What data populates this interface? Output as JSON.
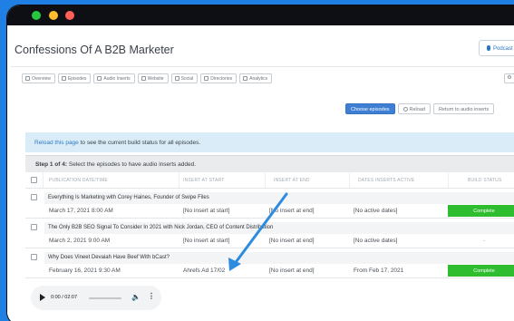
{
  "page": {
    "title": "Confessions Of A B2B Marketer",
    "podcast_button": "Podcast"
  },
  "tabs": [
    {
      "label": "Overview",
      "icon": "dashboard-icon"
    },
    {
      "label": "Episodes",
      "icon": "microphone-icon"
    },
    {
      "label": "Audio Inserts",
      "icon": "audio-wave-icon"
    },
    {
      "label": "Website",
      "icon": "globe-icon"
    },
    {
      "label": "Social",
      "icon": "share-icon"
    },
    {
      "label": "Directories",
      "icon": "list-icon"
    },
    {
      "label": "Analytics",
      "icon": "chart-icon"
    }
  ],
  "actions": {
    "choose_episodes": "Choose episodes",
    "reload": "Reload",
    "return": "Return to audio inserts"
  },
  "info": {
    "link": "Reload this page",
    "text": " to see the current build status for all episodes."
  },
  "step": {
    "label": "Step 1 of 4:",
    "text": " Select the episodes to have audio inserts added."
  },
  "table": {
    "headers": [
      "PUBLICATION DATE/TIME",
      "INSERT AT START",
      "INSERT AT END",
      "DATES INSERTS ACTIVE",
      "BUILD STATUS"
    ],
    "rows": [
      {
        "title": "Everything Is Marketing with Corey Haines, Founder of Swipe Files",
        "date": "March 17, 2021 8:00 AM",
        "start": "[No insert at start]",
        "end": "[No insert at end]",
        "active": "[No active dates]",
        "status": "Complete",
        "status_kind": "ok"
      },
      {
        "title": "The Only B2B SEO Signal To Consider In 2021 with Nick Jordan, CEO of Content Distribution",
        "date": "March 2, 2021 9:00 AM",
        "start": "[No insert at start]",
        "end": "[No insert at end]",
        "active": "[No active dates]",
        "status": "-",
        "status_kind": "none"
      },
      {
        "title": "Why Does Vineet Devaiah Have Beef With bCast?",
        "date": "February 16, 2021 9:30 AM",
        "start": "Ahrefs Ad 17/02",
        "end": "[No insert at end]",
        "active": "From Feb 17, 2021",
        "status": "Complete",
        "status_kind": "ok"
      }
    ]
  },
  "player": {
    "time": "0:00 / 02:07"
  },
  "colors": {
    "background": "#1f7fe3",
    "primary": "#3e7fd3",
    "success": "#2ebd2e",
    "info_bg": "#d9ecf7"
  }
}
